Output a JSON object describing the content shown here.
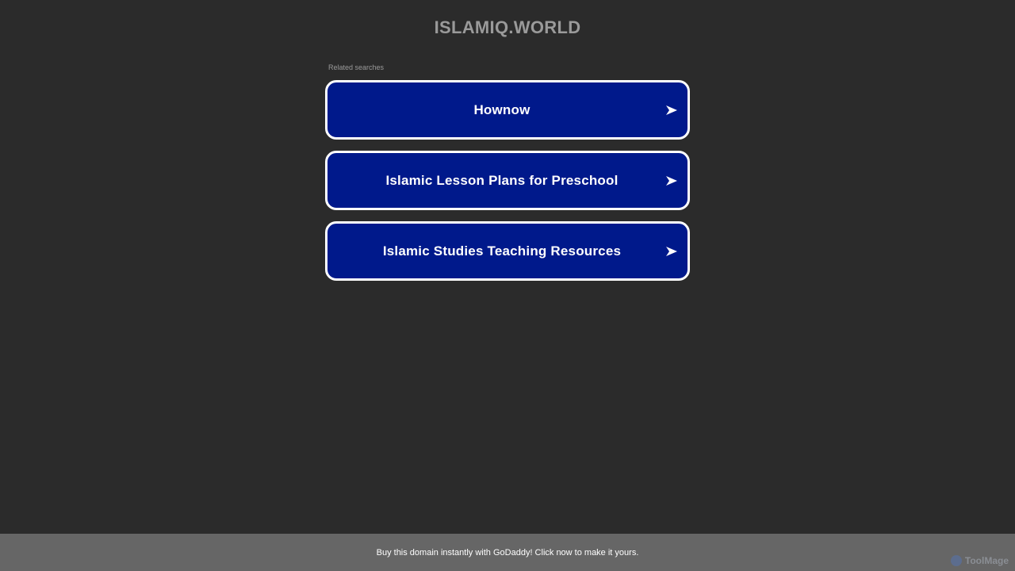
{
  "header": {
    "domain_title": "ISLAMIQ.WORLD"
  },
  "related": {
    "label": "Related searches",
    "items": [
      {
        "label": "Hownow",
        "icon": "arrow-right-icon"
      },
      {
        "label": "Islamic Lesson Plans for Preschool",
        "icon": "arrow-right-icon"
      },
      {
        "label": "Islamic Studies Teaching Resources",
        "icon": "arrow-right-icon"
      }
    ]
  },
  "footer": {
    "text": "Buy this domain instantly with GoDaddy! Click now to make it yours."
  },
  "watermark": {
    "text": "ToolMage",
    "icon": "toolmage-logo-icon"
  },
  "colors": {
    "background": "#2b2b2b",
    "button_fill": "#00198b",
    "button_border": "#ffffff",
    "footer_bg": "#666666",
    "title_text": "#9a9a9a"
  }
}
